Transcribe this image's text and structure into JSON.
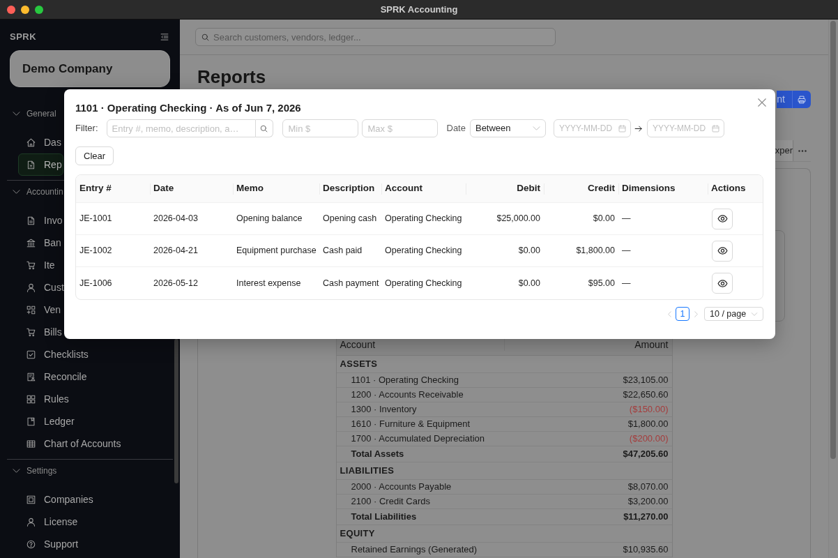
{
  "window": {
    "title": "SPRK Accounting"
  },
  "sidebar": {
    "brand": "SPRK",
    "company": "Demo Company",
    "sections": [
      {
        "label": "General",
        "expanded": true,
        "items": [
          {
            "label": "Das",
            "selected": false
          },
          {
            "label": "Rep",
            "selected": true
          }
        ]
      },
      {
        "label": "Accountin",
        "expanded": true,
        "items": [
          {
            "label": "Invo",
            "selected": false
          },
          {
            "label": "Ban",
            "selected": false
          },
          {
            "label": "Ite",
            "selected": false
          },
          {
            "label": "Cust",
            "selected": false
          },
          {
            "label": "Ven",
            "selected": false
          },
          {
            "label": "Bills",
            "selected": false
          },
          {
            "label": "Checklists",
            "selected": false
          },
          {
            "label": "Reconcile",
            "selected": false
          },
          {
            "label": "Rules",
            "selected": false
          },
          {
            "label": "Ledger",
            "selected": false
          },
          {
            "label": "Chart of Accounts",
            "selected": false
          }
        ]
      },
      {
        "label": "Settings",
        "expanded": true,
        "items": [
          {
            "label": "Companies",
            "selected": false
          },
          {
            "label": "License",
            "selected": false
          },
          {
            "label": "Support",
            "selected": false
          }
        ]
      }
    ]
  },
  "header": {
    "search": {
      "placeholder": "Search customers, vendors, ledger..."
    }
  },
  "page": {
    "title": "Reports",
    "toolbar_button": "nt",
    "tabs": [
      {
        "label": "xper",
        "selected": false
      }
    ],
    "balance_sheet": {
      "columns": [
        "Account",
        "Amount"
      ],
      "rows": [
        {
          "kind": "section",
          "account": "ASSETS"
        },
        {
          "kind": "line",
          "account": "1101 · Operating Checking",
          "amount": "$23,105.00",
          "negative": false
        },
        {
          "kind": "line",
          "account": "1200 · Accounts Receivable",
          "amount": "$22,650.60",
          "negative": false
        },
        {
          "kind": "line",
          "account": "1300 · Inventory",
          "amount": "($150.00)",
          "negative": true
        },
        {
          "kind": "line",
          "account": "1610 · Furniture & Equipment",
          "amount": "$1,800.00",
          "negative": false
        },
        {
          "kind": "line",
          "account": "1700 · Accumulated Depreciation",
          "amount": "($200.00)",
          "negative": true
        },
        {
          "kind": "total",
          "account": "Total Assets",
          "amount": "$47,205.60",
          "negative": false
        },
        {
          "kind": "section",
          "account": "LIABILITIES"
        },
        {
          "kind": "line",
          "account": "2000 · Accounts Payable",
          "amount": "$8,070.00",
          "negative": false
        },
        {
          "kind": "line",
          "account": "2100 · Credit Cards",
          "amount": "$3,200.00",
          "negative": false
        },
        {
          "kind": "total",
          "account": "Total Liabilities",
          "amount": "$11,270.00",
          "negative": false
        },
        {
          "kind": "section",
          "account": "EQUITY"
        },
        {
          "kind": "line",
          "account": "Retained Earnings (Generated)",
          "amount": "$10,935.60",
          "negative": false
        }
      ]
    }
  },
  "modal": {
    "title": "1101 · Operating Checking · As of Jun 7, 2026",
    "filter_label": "Filter:",
    "search": {
      "placeholder": "Entry #, memo, description, a…"
    },
    "min": {
      "placeholder": "Min $"
    },
    "max": {
      "placeholder": "Max $"
    },
    "date_label": "Date",
    "date_mode": {
      "value": "Between"
    },
    "date_from": {
      "placeholder": "YYYY-MM-DD"
    },
    "date_to": {
      "placeholder": "YYYY-MM-DD"
    },
    "clear_button": "Clear",
    "table": {
      "columns": [
        "Entry #",
        "Date",
        "Memo",
        "Description",
        "Account",
        "Debit",
        "Credit",
        "Dimensions",
        "Actions"
      ],
      "rows": [
        {
          "entry": "JE-1001",
          "date": "2026-04-03",
          "memo": "Opening balance",
          "description": "Opening cash",
          "account": "Operating Checking",
          "debit": "$25,000.00",
          "credit": "$0.00",
          "dimensions": "—"
        },
        {
          "entry": "JE-1002",
          "date": "2026-04-21",
          "memo": "Equipment purchase",
          "description": "Cash paid",
          "account": "Operating Checking",
          "debit": "$0.00",
          "credit": "$1,800.00",
          "dimensions": "—"
        },
        {
          "entry": "JE-1006",
          "date": "2026-05-12",
          "memo": "Interest expense",
          "description": "Cash payment",
          "account": "Operating Checking",
          "debit": "$0.00",
          "credit": "$95.00",
          "dimensions": "—"
        }
      ]
    },
    "pagination": {
      "previous_disabled": true,
      "pages": [
        {
          "label": "1",
          "selected": true
        }
      ],
      "next_disabled": true,
      "page_size": {
        "value": "10 / page"
      }
    }
  }
}
